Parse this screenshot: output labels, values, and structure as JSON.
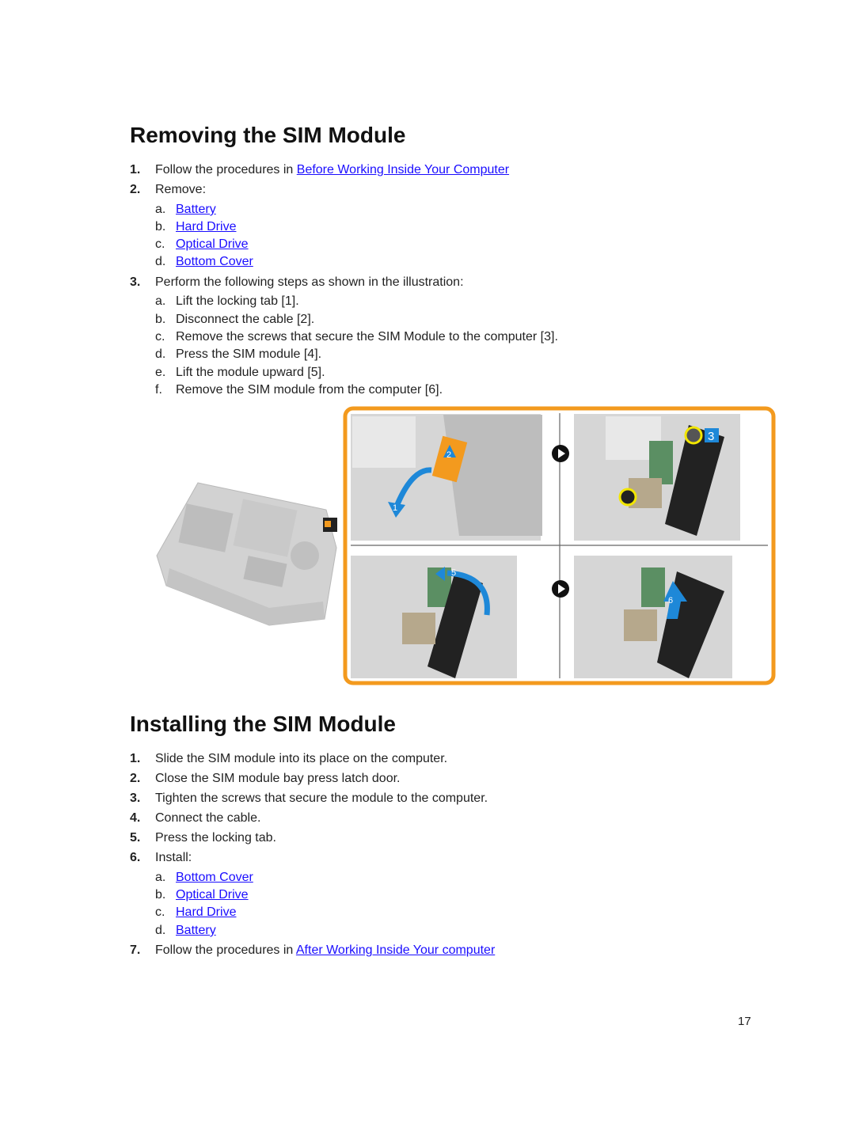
{
  "removing": {
    "title": "Removing the SIM Module",
    "steps": [
      {
        "num": "1.",
        "text": "Follow the procedures in ",
        "link": "Before Working Inside Your Computer"
      },
      {
        "num": "2.",
        "text": "Remove:",
        "sub": [
          {
            "letter": "a.",
            "link": "Battery"
          },
          {
            "letter": "b.",
            "link": "Hard Drive"
          },
          {
            "letter": "c.",
            "link": "Optical Drive"
          },
          {
            "letter": "d.",
            "link": "Bottom Cover"
          }
        ]
      },
      {
        "num": "3.",
        "text": "Perform the following steps as shown in the illustration:",
        "sub": [
          {
            "letter": "a.",
            "text": "Lift the locking tab [1]."
          },
          {
            "letter": "b.",
            "text": "Disconnect the cable [2]."
          },
          {
            "letter": "c.",
            "text": "Remove the screws that secure the SIM Module to the computer [3]."
          },
          {
            "letter": "d.",
            "text": "Press the SIM module [4]."
          },
          {
            "letter": "e.",
            "text": "Lift the module upward [5]."
          },
          {
            "letter": "f.",
            "text": "Remove the SIM module from the computer [6]."
          }
        ]
      }
    ]
  },
  "illustration": {
    "callouts": [
      "1",
      "2",
      "3",
      "5",
      "6"
    ],
    "frame_color": "#f39a1e",
    "arrow_color": "#1e88d8",
    "screw_highlight_color": "#f2e600"
  },
  "installing": {
    "title": "Installing the SIM Module",
    "steps": [
      {
        "num": "1.",
        "text": "Slide the SIM module into its place on the computer."
      },
      {
        "num": "2.",
        "text": "Close the SIM module bay press latch door."
      },
      {
        "num": "3.",
        "text": "Tighten the screws that secure the module to the computer."
      },
      {
        "num": "4.",
        "text": "Connect the cable."
      },
      {
        "num": "5.",
        "text": "Press the locking tab."
      },
      {
        "num": "6.",
        "text": "Install:",
        "sub": [
          {
            "letter": "a.",
            "link": "Bottom Cover"
          },
          {
            "letter": "b.",
            "link": "Optical Drive"
          },
          {
            "letter": "c.",
            "link": "Hard Drive"
          },
          {
            "letter": "d.",
            "link": "Battery"
          }
        ]
      },
      {
        "num": "7.",
        "text": "Follow the procedures in ",
        "link": "After Working Inside Your computer"
      }
    ]
  },
  "page_number": "17"
}
